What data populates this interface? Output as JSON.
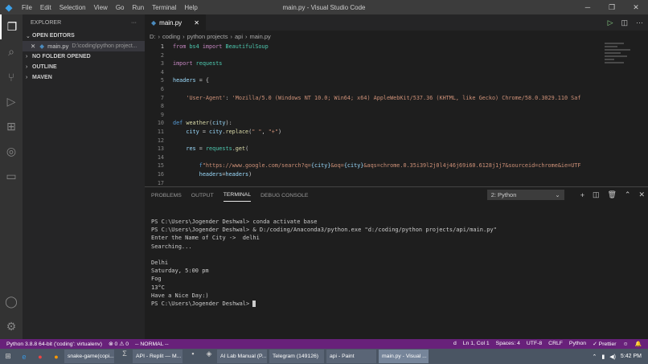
{
  "title": {
    "menu": [
      "File",
      "Edit",
      "Selection",
      "View",
      "Go",
      "Run",
      "Terminal",
      "Help"
    ],
    "window_title": "main.py - Visual Studio Code"
  },
  "sidebar": {
    "title": "EXPLORER",
    "more": "···",
    "open_editors": "OPEN EDITORS",
    "open_file": {
      "name": "main.py",
      "path": "D:\\coding\\python project..."
    },
    "sections": [
      "NO FOLDER OPENED",
      "OUTLINE",
      "MAVEN"
    ]
  },
  "editor": {
    "tab": "main.py",
    "breadcrumb": [
      "D:",
      "coding",
      "python projects",
      "api",
      "main.py"
    ],
    "lines": [
      [
        {
          "t": "from ",
          "c": "kw"
        },
        {
          "t": "bs4 ",
          "c": "md"
        },
        {
          "t": "import ",
          "c": "kw"
        },
        {
          "t": "BeautifulSoup",
          "c": "md"
        }
      ],
      [],
      [
        {
          "t": "import ",
          "c": "kw"
        },
        {
          "t": "requests",
          "c": "md"
        }
      ],
      [],
      [
        {
          "t": "headers",
          "c": "vr"
        },
        {
          "t": " = {",
          "c": ""
        }
      ],
      [],
      [
        {
          "t": "    'User-Agent'",
          "c": "st"
        },
        {
          "t": ": ",
          "c": ""
        },
        {
          "t": "'Mozilla/5.0 (Windows NT 10.0; Win64; x64) AppleWebKit/537.36 (KHTML, like Gecko) Chrome/58.0.3029.110 Saf",
          "c": "st"
        }
      ],
      [],
      [],
      [
        {
          "t": "def ",
          "c": "bl"
        },
        {
          "t": "weather",
          "c": "fn"
        },
        {
          "t": "(",
          "c": ""
        },
        {
          "t": "city",
          "c": "vr"
        },
        {
          "t": "):",
          "c": ""
        }
      ],
      [
        {
          "t": "    city",
          "c": "vr"
        },
        {
          "t": " = ",
          "c": ""
        },
        {
          "t": "city",
          "c": "vr"
        },
        {
          "t": ".",
          "c": ""
        },
        {
          "t": "replace",
          "c": "fn"
        },
        {
          "t": "(",
          "c": ""
        },
        {
          "t": "\" \"",
          "c": "st"
        },
        {
          "t": ", ",
          "c": ""
        },
        {
          "t": "\"+\"",
          "c": "st"
        },
        {
          "t": ")",
          "c": ""
        }
      ],
      [],
      [
        {
          "t": "    res",
          "c": "vr"
        },
        {
          "t": " = ",
          "c": ""
        },
        {
          "t": "requests",
          "c": "md"
        },
        {
          "t": ".",
          "c": ""
        },
        {
          "t": "get",
          "c": "fn"
        },
        {
          "t": "(",
          "c": ""
        }
      ],
      [],
      [
        {
          "t": "        f",
          "c": "bl"
        },
        {
          "t": "\"https://www.google.com/search?q=",
          "c": "st"
        },
        {
          "t": "{city}",
          "c": "vr"
        },
        {
          "t": "&oq=",
          "c": "st"
        },
        {
          "t": "{city}",
          "c": "vr"
        },
        {
          "t": "&aqs=chrome.0.35i39l2j0l4j46j69i60.6128j1j7&sourceid=chrome&ie=UTF",
          "c": "st"
        }
      ],
      [
        {
          "t": "        headers",
          "c": "vr"
        },
        {
          "t": "=",
          "c": ""
        },
        {
          "t": "headers",
          "c": "vr"
        },
        {
          "t": ")",
          "c": ""
        }
      ],
      []
    ]
  },
  "panel": {
    "tabs": [
      "PROBLEMS",
      "OUTPUT",
      "TERMINAL",
      "DEBUG CONSOLE"
    ],
    "active_tab": "TERMINAL",
    "terminal_select": "2: Python",
    "terminal_lines": [
      "PS C:\\Users\\Jogender Deshwal> conda activate base",
      "PS C:\\Users\\Jogender Deshwal> & D:/coding/Anaconda3/python.exe \"d:/coding/python projects/api/main.py\"",
      "Enter the Name of City ->  delhi",
      "Searching...",
      "",
      "Delhi",
      "Saturday, 5:00 pm",
      "Fog",
      "13°C",
      "Have a Nice Day:)"
    ],
    "prompt": "PS C:\\Users\\Jogender Deshwal> "
  },
  "status": {
    "interpreter": "Python 3.8.8 64-bit ('coding': virtualenv)",
    "problems": "⊗ 0 ⚠ 0",
    "mode": "-- NORMAL --",
    "right": [
      "d",
      "Ln 1, Col 1",
      "Spaces: 4",
      "UTF-8",
      "CRLF",
      "Python",
      "✓ Prettier"
    ]
  },
  "taskbar": {
    "apps": [
      "snake-game(copi...",
      "API - Replit — M...",
      "AI Lab Manual (P...",
      "Telegram (149126)",
      "api - Paint",
      "main.py - Visual ..."
    ],
    "time": "5:42 PM"
  },
  "colors": {
    "status": "#68217a",
    "accent": "#007acc"
  }
}
